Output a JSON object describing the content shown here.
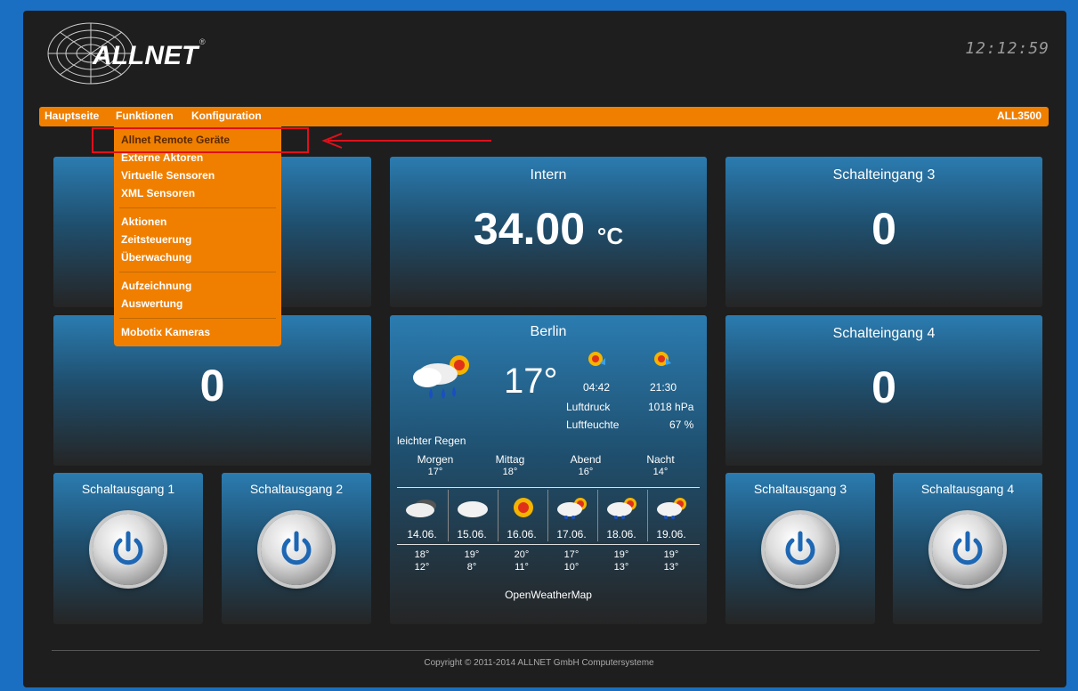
{
  "app": {
    "logo_text": "ALLNET",
    "clock": "12:12:59",
    "model": "ALL3500",
    "copyright": "Copyright © 2011-2014 ALLNET GmbH Computersysteme"
  },
  "menu": {
    "items": [
      "Hauptseite",
      "Funktionen",
      "Konfiguration"
    ],
    "dropdown": {
      "group1": [
        "Allnet Remote Geräte",
        "Externe Aktoren",
        "Virtuelle Sensoren",
        "XML Sensoren"
      ],
      "group2": [
        "Aktionen",
        "Zeitsteuerung",
        "Überwachung"
      ],
      "group3": [
        "Aufzeichnung",
        "Auswertung"
      ],
      "group4": [
        "Mobotix Kameras"
      ]
    }
  },
  "tiles": {
    "intern": {
      "title": "Intern",
      "value": "34.00",
      "unit": "°C"
    },
    "schalteingang3": {
      "title": "Schalteingang 3",
      "value": "0"
    },
    "schalteingang4": {
      "title": "Schalteingang 4",
      "value": "0"
    },
    "left_middle": {
      "value": "0"
    }
  },
  "buttons": {
    "out1": "Schaltausgang 1",
    "out2": "Schaltausgang 2",
    "out3": "Schaltausgang 3",
    "out4": "Schaltausgang 4"
  },
  "weather": {
    "city": "Berlin",
    "temp": "17°",
    "sunrise": "04:42",
    "sunset": "21:30",
    "pressure_label": "Luftdruck",
    "pressure": "1018 hPa",
    "humidity_label": "Luftfeuchte",
    "humidity": "67 %",
    "condition": "leichter Regen",
    "daytimes": [
      {
        "label": "Morgen",
        "temp": "17°"
      },
      {
        "label": "Mittag",
        "temp": "18°"
      },
      {
        "label": "Abend",
        "temp": "16°"
      },
      {
        "label": "Nacht",
        "temp": "14°"
      }
    ],
    "forecast": [
      {
        "date": "14.06.",
        "max": "18°",
        "min": "12°",
        "icon": "cloudy-icon"
      },
      {
        "date": "15.06.",
        "max": "19°",
        "min": "8°",
        "icon": "cloud-icon"
      },
      {
        "date": "16.06.",
        "max": "20°",
        "min": "11°",
        "icon": "sun-icon"
      },
      {
        "date": "17.06.",
        "max": "17°",
        "min": "10°",
        "icon": "rain-sun-icon"
      },
      {
        "date": "18.06.",
        "max": "19°",
        "min": "13°",
        "icon": "rain-sun-icon"
      },
      {
        "date": "19.06.",
        "max": "19°",
        "min": "13°",
        "icon": "rain-sun-icon"
      }
    ],
    "source": "OpenWeatherMap"
  },
  "colors": {
    "accent": "#f07f00",
    "tile_top": "#2b7cb1",
    "highlight": "#e0101a"
  }
}
